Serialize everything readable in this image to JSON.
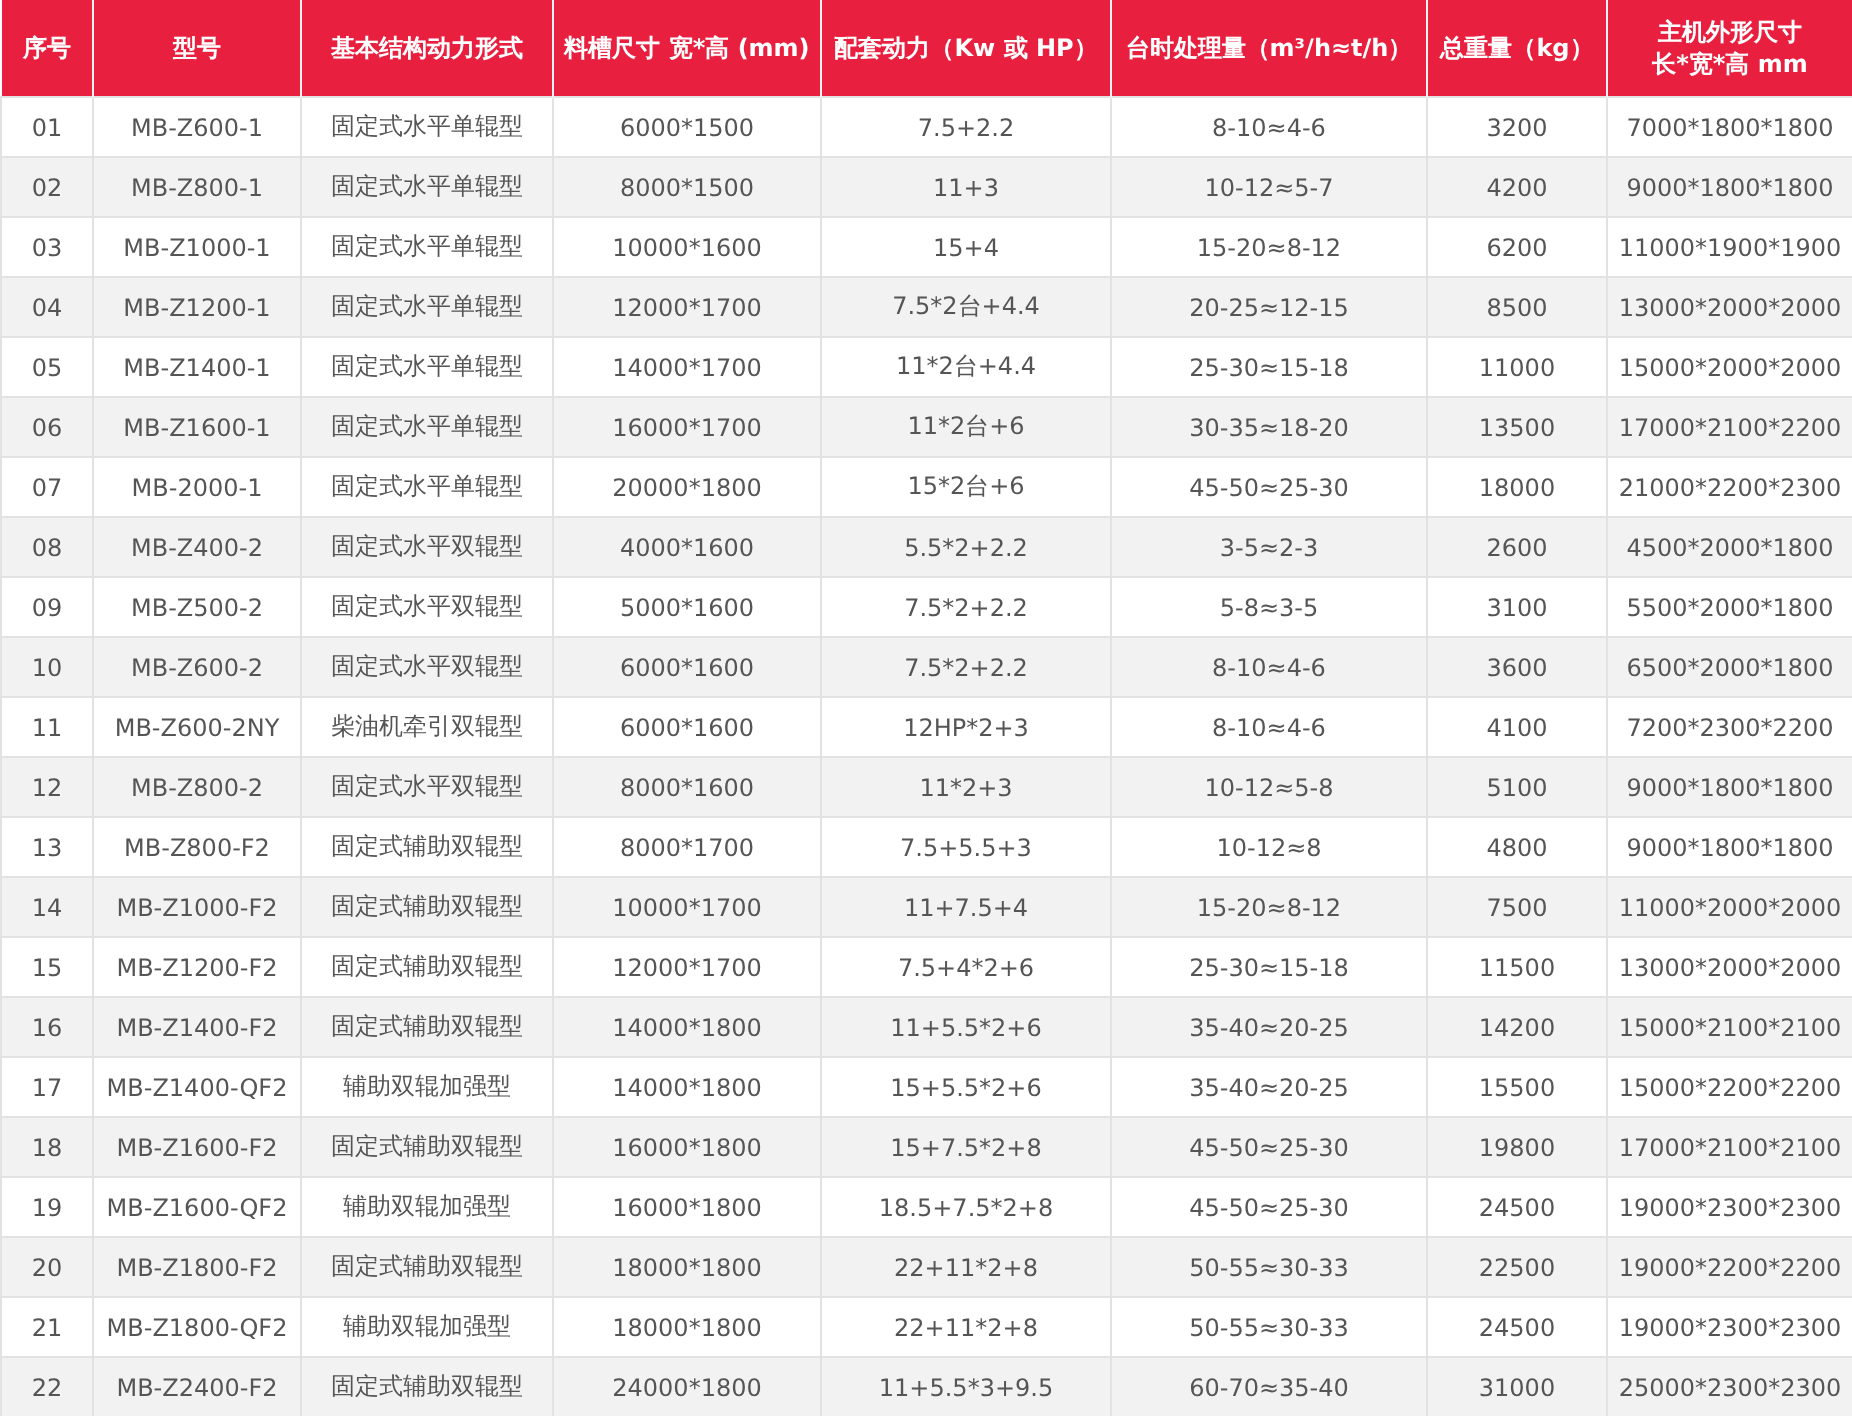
{
  "table": {
    "columns": [
      "序号",
      "型号",
      "基本结构动力形式",
      "料槽尺寸 宽*高 (mm)",
      "配套动力（Kw 或 HP）",
      "台时处理量（m³/h≈t/h）",
      "总重量（kg）",
      "主机外形尺寸长*宽*高 mm"
    ],
    "rows": [
      [
        "01",
        "MB-Z600-1",
        "固定式水平单辊型",
        "6000*1500",
        "7.5+2.2",
        "8-10≈4-6",
        "3200",
        "7000*1800*1800"
      ],
      [
        "02",
        "MB-Z800-1",
        "固定式水平单辊型",
        "8000*1500",
        "11+3",
        "10-12≈5-7",
        "4200",
        "9000*1800*1800"
      ],
      [
        "03",
        "MB-Z1000-1",
        "固定式水平单辊型",
        "10000*1600",
        "15+4",
        "15-20≈8-12",
        "6200",
        "11000*1900*1900"
      ],
      [
        "04",
        "MB-Z1200-1",
        "固定式水平单辊型",
        "12000*1700",
        "7.5*2台+4.4",
        "20-25≈12-15",
        "8500",
        "13000*2000*2000"
      ],
      [
        "05",
        "MB-Z1400-1",
        "固定式水平单辊型",
        "14000*1700",
        "11*2台+4.4",
        "25-30≈15-18",
        "11000",
        "15000*2000*2000"
      ],
      [
        "06",
        "MB-Z1600-1",
        "固定式水平单辊型",
        "16000*1700",
        "11*2台+6",
        "30-35≈18-20",
        "13500",
        "17000*2100*2200"
      ],
      [
        "07",
        "MB-2000-1",
        "固定式水平单辊型",
        "20000*1800",
        "15*2台+6",
        "45-50≈25-30",
        "18000",
        "21000*2200*2300"
      ],
      [
        "08",
        "MB-Z400-2",
        "固定式水平双辊型",
        "4000*1600",
        "5.5*2+2.2",
        "3-5≈2-3",
        "2600",
        "4500*2000*1800"
      ],
      [
        "09",
        "MB-Z500-2",
        "固定式水平双辊型",
        "5000*1600",
        "7.5*2+2.2",
        "5-8≈3-5",
        "3100",
        "5500*2000*1800"
      ],
      [
        "10",
        "MB-Z600-2",
        "固定式水平双辊型",
        "6000*1600",
        "7.5*2+2.2",
        "8-10≈4-6",
        "3600",
        "6500*2000*1800"
      ],
      [
        "11",
        "MB-Z600-2NY",
        "柴油机牵引双辊型",
        "6000*1600",
        "12HP*2+3",
        "8-10≈4-6",
        "4100",
        "7200*2300*2200"
      ],
      [
        "12",
        "MB-Z800-2",
        "固定式水平双辊型",
        "8000*1600",
        "11*2+3",
        "10-12≈5-8",
        "5100",
        "9000*1800*1800"
      ],
      [
        "13",
        "MB-Z800-F2",
        "固定式辅助双辊型",
        "8000*1700",
        "7.5+5.5+3",
        "10-12≈8",
        "4800",
        "9000*1800*1800"
      ],
      [
        "14",
        "MB-Z1000-F2",
        "固定式辅助双辊型",
        "10000*1700",
        "11+7.5+4",
        "15-20≈8-12",
        "7500",
        "11000*2000*2000"
      ],
      [
        "15",
        "MB-Z1200-F2",
        "固定式辅助双辊型",
        "12000*1700",
        "7.5+4*2+6",
        "25-30≈15-18",
        "11500",
        "13000*2000*2000"
      ],
      [
        "16",
        "MB-Z1400-F2",
        "固定式辅助双辊型",
        "14000*1800",
        "11+5.5*2+6",
        "35-40≈20-25",
        "14200",
        "15000*2100*2100"
      ],
      [
        "17",
        "MB-Z1400-QF2",
        "辅助双辊加强型",
        "14000*1800",
        "15+5.5*2+6",
        "35-40≈20-25",
        "15500",
        "15000*2200*2200"
      ],
      [
        "18",
        "MB-Z1600-F2",
        "固定式辅助双辊型",
        "16000*1800",
        "15+7.5*2+8",
        "45-50≈25-30",
        "19800",
        "17000*2100*2100"
      ],
      [
        "19",
        "MB-Z1600-QF2",
        "辅助双辊加强型",
        "16000*1800",
        "18.5+7.5*2+8",
        "45-50≈25-30",
        "24500",
        "19000*2300*2300"
      ],
      [
        "20",
        "MB-Z1800-F2",
        "固定式辅助双辊型",
        "18000*1800",
        "22+11*2+8",
        "50-55≈30-33",
        "22500",
        "19000*2200*2200"
      ],
      [
        "21",
        "MB-Z1800-QF2",
        "辅助双辊加强型",
        "18000*1800",
        "22+11*2+8",
        "50-55≈30-33",
        "24500",
        "19000*2300*2300"
      ],
      [
        "22",
        "MB-Z2400-F2",
        "固定式辅助双辊型",
        "24000*1800",
        "11+5.5*3+9.5",
        "60-70≈35-40",
        "31000",
        "25000*2300*2300"
      ]
    ]
  }
}
